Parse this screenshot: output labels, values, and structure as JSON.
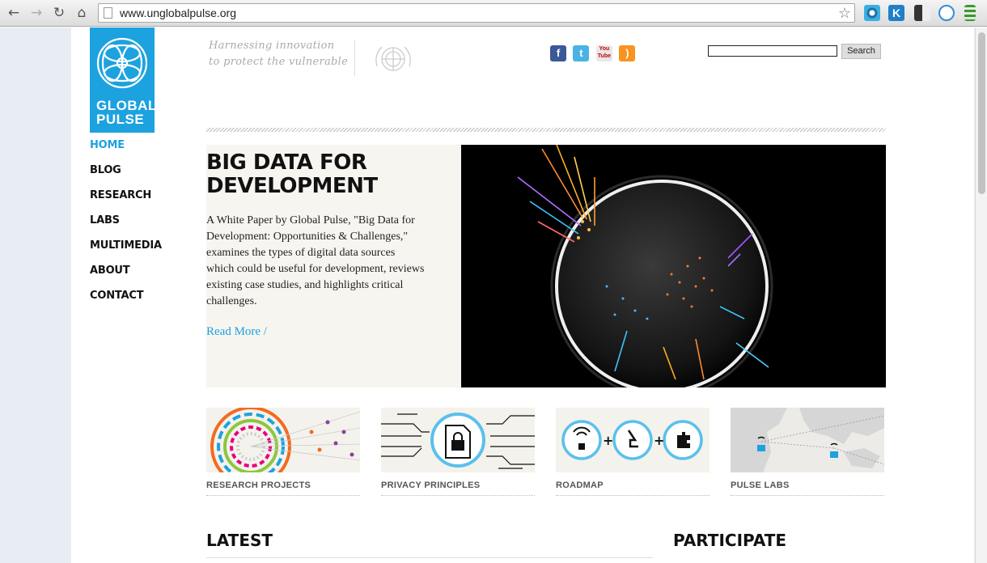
{
  "browser": {
    "url": "www.unglobalpulse.org",
    "back": "←",
    "forward": "→",
    "reload": "↻",
    "home": "⌂",
    "star": "☆"
  },
  "site": {
    "logo_line1": "GLOBAL",
    "logo_line2": "PULSE",
    "tagline_line1": "Harnessing innovation",
    "tagline_line2": "to protect the vulnerable",
    "search_button": "Search"
  },
  "social": [
    {
      "icon": "facebook-icon",
      "glyph": "f"
    },
    {
      "icon": "twitter-icon",
      "glyph": "t"
    },
    {
      "icon": "youtube-icon",
      "glyph": "You Tube"
    },
    {
      "icon": "rss-icon",
      "glyph": ")"
    }
  ],
  "nav": {
    "items": [
      "HOME",
      "BLOG",
      "RESEARCH",
      "LABS",
      "MULTIMEDIA",
      "ABOUT",
      "CONTACT"
    ],
    "active": "HOME"
  },
  "feature": {
    "title_line1": "BIG DATA FOR",
    "title_line2": "DEVELOPMENT",
    "body": "A White Paper by Global Pulse, \"Big Data for Development: Opportunities & Challenges,\" examines the types of digital data sources which could be useful for development, reviews existing case studies, and highlights critical challenges.",
    "read_more": "Read More /"
  },
  "tiles": [
    {
      "label": "RESEARCH PROJECTS"
    },
    {
      "label": "PRIVACY PRINCIPLES"
    },
    {
      "label": "ROADMAP"
    },
    {
      "label": "PULSE LABS"
    }
  ],
  "sections": {
    "latest": "LATEST",
    "participate": "PARTICIPATE"
  },
  "colors": {
    "brand_blue": "#1ca2df",
    "text": "#111111",
    "feature_bg": "#f7f5f0"
  }
}
